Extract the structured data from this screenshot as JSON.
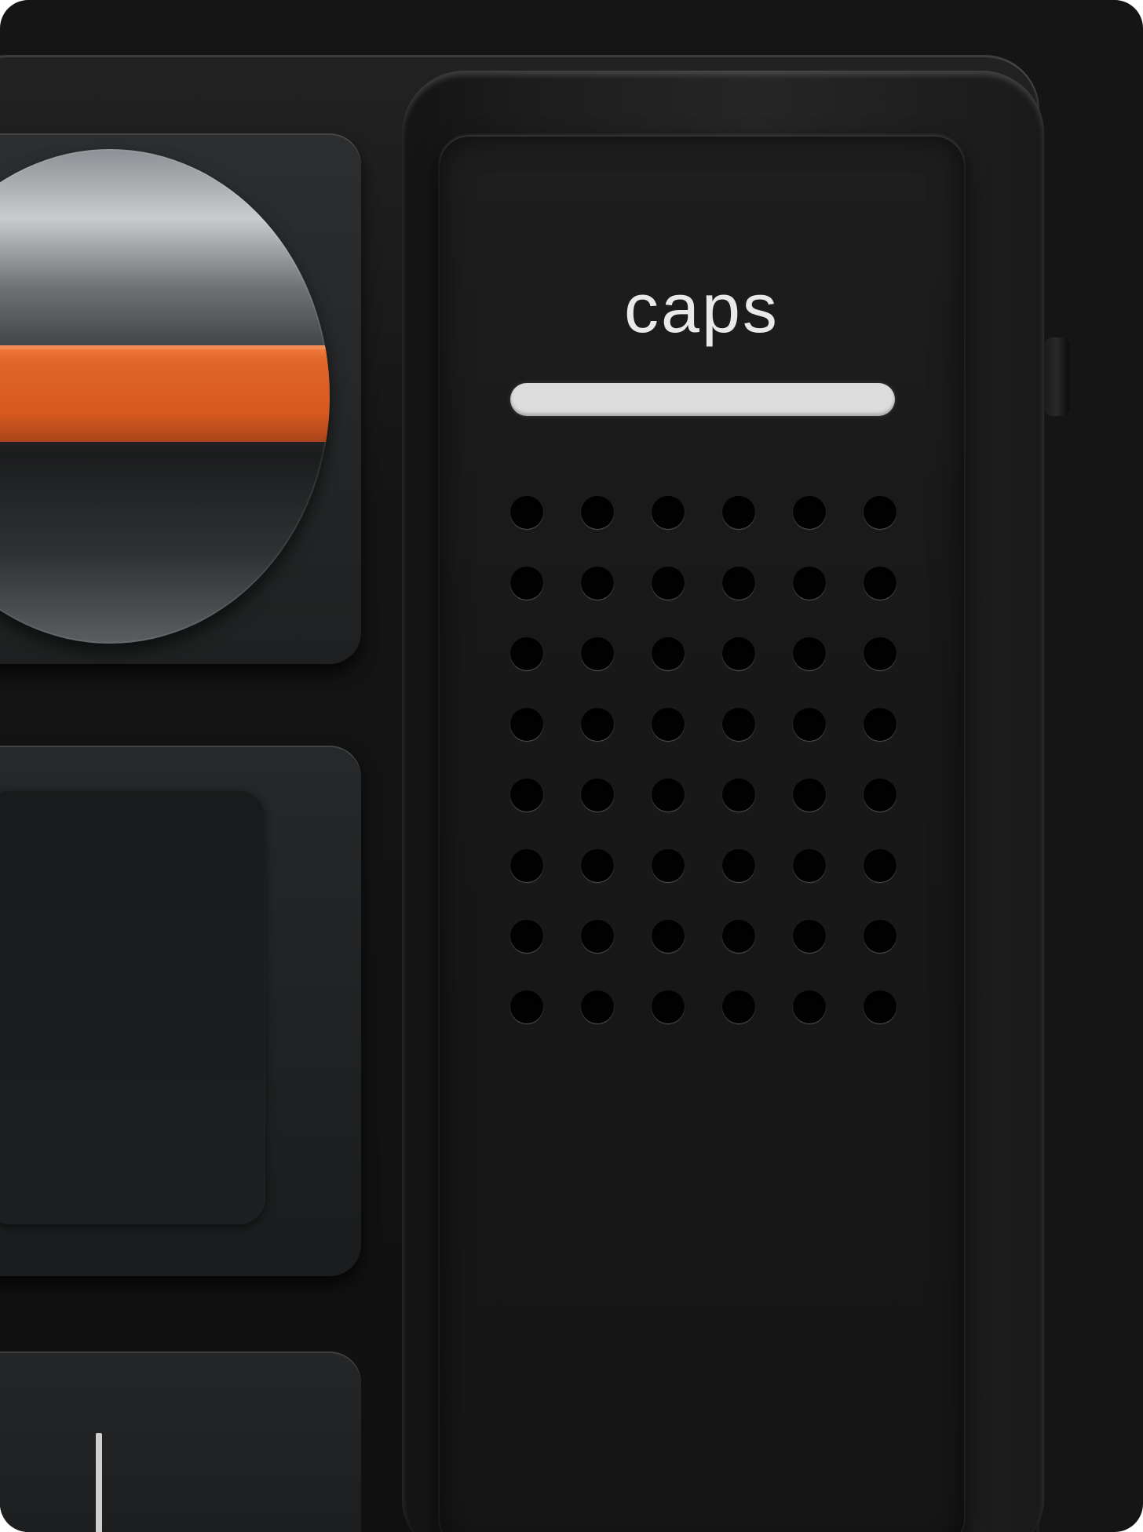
{
  "caps_key": {
    "label": "caps",
    "indicator_color": "#dcdcdc"
  },
  "grille": {
    "rows": 8,
    "cols": 6
  },
  "knob": {
    "accent_color": "#e0662a"
  },
  "colors": {
    "body": "#151515",
    "key": "#1e1e1e"
  }
}
